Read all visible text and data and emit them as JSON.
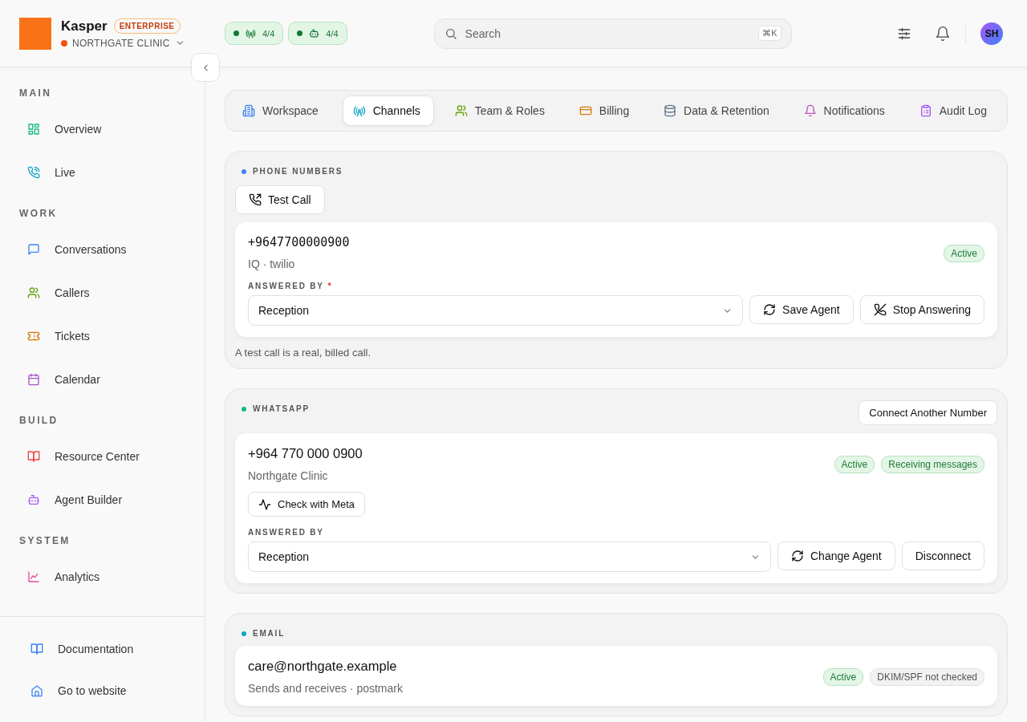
{
  "brand": {
    "name": "Kasper",
    "plan": "ENTERPRISE",
    "org": "NORTHGATE CLINIC"
  },
  "header": {
    "statuses": [
      {
        "count": "4/4"
      },
      {
        "count": "4/4"
      }
    ],
    "search": {
      "placeholder": "Search",
      "shortcut": "⌘K"
    },
    "avatar": "SH"
  },
  "sidebar": {
    "sections": [
      {
        "title": "MAIN",
        "items": [
          {
            "label": "Overview"
          },
          {
            "label": "Live"
          }
        ]
      },
      {
        "title": "WORK",
        "items": [
          {
            "label": "Conversations"
          },
          {
            "label": "Callers"
          },
          {
            "label": "Tickets"
          },
          {
            "label": "Calendar"
          }
        ]
      },
      {
        "title": "BUILD",
        "items": [
          {
            "label": "Resource Center"
          },
          {
            "label": "Agent Builder"
          }
        ]
      },
      {
        "title": "SYSTEM",
        "items": [
          {
            "label": "Analytics"
          }
        ]
      }
    ],
    "footer": [
      {
        "label": "Documentation"
      },
      {
        "label": "Go to website"
      }
    ]
  },
  "tabs": [
    {
      "label": "Workspace",
      "selected": false
    },
    {
      "label": "Channels",
      "selected": true
    },
    {
      "label": "Team & Roles",
      "selected": false
    },
    {
      "label": "Billing",
      "selected": false
    },
    {
      "label": "Data & Retention",
      "selected": false
    },
    {
      "label": "Notifications",
      "selected": false
    },
    {
      "label": "Audit Log",
      "selected": false
    }
  ],
  "sections": [
    {
      "title": "PHONE NUMBERS",
      "color": "#3b82f6",
      "actions": [
        {
          "label": "Test Call"
        }
      ],
      "cards": [
        {
          "kind": "phone",
          "value": "+9647700000900",
          "subtitle": "IQ · twilio",
          "badges": [
            {
              "label": "Active",
              "kind": "success"
            }
          ],
          "answered_by": {
            "label": "ANSWERED BY",
            "required_mark": "*",
            "value": "Reception"
          },
          "buttons": [
            {
              "label": "Save Agent",
              "kind": "change"
            },
            {
              "label": "Stop Answering",
              "kind": "stop"
            }
          ]
        }
      ],
      "note": "A test call is a real, billed call."
    },
    {
      "title": "WHATSAPP",
      "color": "#10b981",
      "header_action": "Connect Another Number",
      "cards": [
        {
          "kind": "whatsapp",
          "value": "+964 770 000 0900",
          "subtitle": "Northgate Clinic",
          "badges": [
            {
              "label": "Active",
              "kind": "success"
            },
            {
              "label": "Receiving messages",
              "kind": "success"
            }
          ],
          "check": "Check with Meta",
          "answered_by": {
            "label": "ANSWERED BY",
            "value": "Reception"
          },
          "buttons": [
            {
              "label": "Change Agent",
              "kind": "change"
            },
            {
              "label": "Disconnect",
              "kind": "disconnect"
            }
          ]
        }
      ]
    },
    {
      "title": "EMAIL",
      "color": "#0ea5c6",
      "cards": [
        {
          "kind": "email",
          "value": "care@northgate.example",
          "subtitle": "Sends and receives · postmark",
          "badges": [
            {
              "label": "Active",
              "kind": "success"
            },
            {
              "label": "DKIM/SPF not checked",
              "kind": "neutral"
            }
          ]
        }
      ]
    }
  ]
}
